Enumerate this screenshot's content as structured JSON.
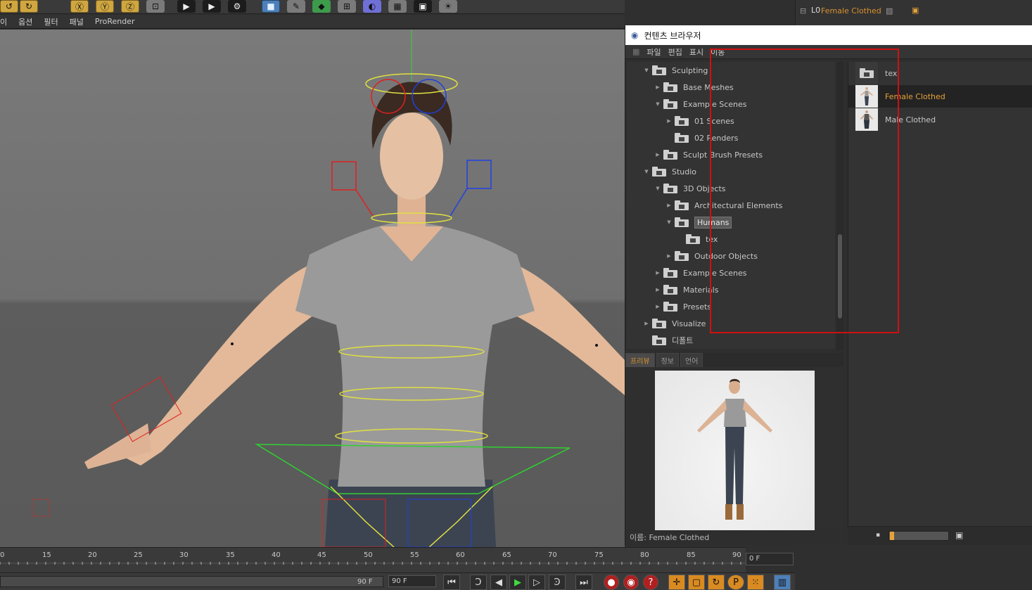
{
  "colors": {
    "accent_orange": "#e6a23a",
    "highlight_red": "#d01010",
    "folder": "#d0d0d0"
  },
  "toolbar": {
    "icons": [
      "undo-icon",
      "redo-icon",
      "x-axis-icon",
      "y-axis-icon",
      "z-axis-icon",
      "coordinate-system-icon",
      "render-view-icon",
      "render-picture-icon",
      "edit-render-settings-icon",
      "cube-icon",
      "spline-pen-icon",
      "subdivision-icon",
      "array-icon",
      "deformer-icon",
      "floor-icon",
      "camera-icon",
      "light-icon"
    ]
  },
  "viewport_menu": {
    "items": [
      "이",
      "옵션",
      "필터",
      "패널",
      "ProRender"
    ]
  },
  "object_manager": {
    "selected_object": "Female Clothed"
  },
  "content_browser": {
    "title": "컨텐츠 브라우저",
    "menu": [
      "파일",
      "편집",
      "표시",
      "이동"
    ],
    "tree": [
      {
        "label": "Sculpting",
        "depth": 1,
        "expanded": true,
        "selected": false
      },
      {
        "label": "Base Meshes",
        "depth": 2,
        "expanded": false,
        "selected": false
      },
      {
        "label": "Example Scenes",
        "depth": 2,
        "expanded": true,
        "selected": false
      },
      {
        "label": "01 Scenes",
        "depth": 3,
        "expanded": false,
        "selected": false
      },
      {
        "label": "02 Renders",
        "depth": 3,
        "expanded": false,
        "selected": false
      },
      {
        "label": "Sculpt Brush Presets",
        "depth": 2,
        "expanded": false,
        "selected": false
      },
      {
        "label": "Studio",
        "depth": 1,
        "expanded": true,
        "selected": false
      },
      {
        "label": "3D Objects",
        "depth": 2,
        "expanded": true,
        "selected": false
      },
      {
        "label": "Architectural Elements",
        "depth": 3,
        "expanded": false,
        "selected": false
      },
      {
        "label": "Humans",
        "depth": 3,
        "expanded": true,
        "selected": true
      },
      {
        "label": "tex",
        "depth": 4,
        "expanded": false,
        "selected": false
      },
      {
        "label": "Outdoor Objects",
        "depth": 3,
        "expanded": false,
        "selected": false
      },
      {
        "label": "Example Scenes",
        "depth": 2,
        "expanded": false,
        "selected": false
      },
      {
        "label": "Materials",
        "depth": 2,
        "expanded": false,
        "selected": false
      },
      {
        "label": "Presets",
        "depth": 2,
        "expanded": false,
        "selected": false
      },
      {
        "label": "Visualize",
        "depth": 1,
        "expanded": false,
        "selected": false
      },
      {
        "label": "디폴트",
        "depth": 1,
        "expanded": false,
        "selected": false
      }
    ],
    "preview_tabs": [
      "프리뷰",
      "정보",
      "언어"
    ],
    "preview_name_label": "이름: Female Clothed",
    "files": [
      {
        "label": "tex",
        "kind": "folder",
        "selected": false
      },
      {
        "label": "Female Clothed",
        "kind": "model",
        "selected": true
      },
      {
        "label": "Male Clothed",
        "kind": "model",
        "selected": false
      }
    ]
  },
  "timeline": {
    "ticks": [
      "0",
      "15",
      "20",
      "25",
      "30",
      "35",
      "40",
      "45",
      "50",
      "55",
      "60",
      "65",
      "70",
      "75",
      "80",
      "85",
      "90"
    ],
    "current_frame": "0 F",
    "range_end": "90 F",
    "end_frame": "90 F"
  },
  "playback": {
    "buttons": [
      "go-to-start-icon",
      "previous-key-icon",
      "previous-frame-icon",
      "play-icon",
      "next-frame-icon",
      "next-key-icon",
      "go-to-end-icon",
      "record-icon",
      "autokey-icon",
      "keyframe-selection-icon",
      "move-key-icon",
      "scale-key-icon",
      "rotate-key-icon",
      "param-key-icon",
      "pla-key-icon",
      "timeline-icon"
    ]
  }
}
